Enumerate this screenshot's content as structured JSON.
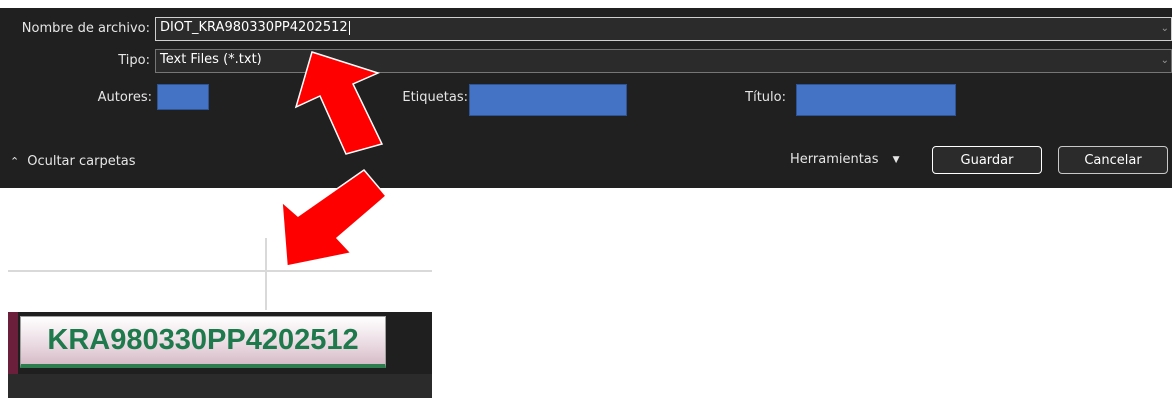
{
  "dialog": {
    "filename_label": "Nombre de archivo:",
    "filename_value": "DIOT_KRA980330PP4202512",
    "type_label": "Tipo:",
    "type_value": "Text Files (*.txt)",
    "authors_label": "Autores:",
    "tags_label": "Etiquetas:",
    "title_label": "Título:",
    "hide_folders_label": "Ocultar carpetas",
    "tools_label": "Herramientas",
    "save_label": "Guardar",
    "cancel_label": "Cancelar",
    "metadata_box_color": "#4472c4"
  },
  "sheet": {
    "tab_label": "KRA980330PP4202512",
    "tab_text_color": "#1e7a4c"
  },
  "annotations": {
    "arrow_color": "#ff0000",
    "arrows": [
      "arrow-up-to-filename",
      "arrow-down-to-sheet-tab"
    ]
  }
}
